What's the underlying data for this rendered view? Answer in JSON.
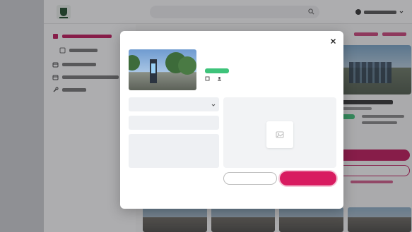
{
  "colors": {
    "accent": "#d81b60",
    "accent_dark": "#c2185b",
    "status_green": "#3ec37a",
    "brand_green": "#1f4d2b"
  },
  "topbar": {
    "search_placeholder": "",
    "user_name": ""
  },
  "sidebar": {
    "items": [
      {
        "label": "",
        "icon": "warning-icon",
        "active": true
      },
      {
        "label": "",
        "icon": "list-icon",
        "active": false
      },
      {
        "label": "",
        "icon": "calendar-icon",
        "active": false
      },
      {
        "label": "",
        "icon": "calendar-icon",
        "active": false
      },
      {
        "label": "",
        "icon": "wrench-icon",
        "active": false
      }
    ]
  },
  "modal": {
    "title": "",
    "site": {
      "name": "",
      "address_line1": "",
      "address_line2": "",
      "status_badge": "",
      "reference": "",
      "equipment_count": "",
      "face_type": "",
      "last_update": ""
    },
    "form": {
      "type_label": "",
      "type_value": "",
      "subject_label": "",
      "subject_value": "",
      "description_label": "",
      "description_value": ""
    },
    "upload_label": "",
    "upload_icon": "image-upload-icon",
    "cancel_label": "",
    "submit_label": "",
    "history_link": ""
  },
  "background": {
    "header_links": [
      "",
      ""
    ],
    "card": {
      "status_badge": "",
      "primary_button": "",
      "secondary_button": "",
      "link": ""
    }
  }
}
